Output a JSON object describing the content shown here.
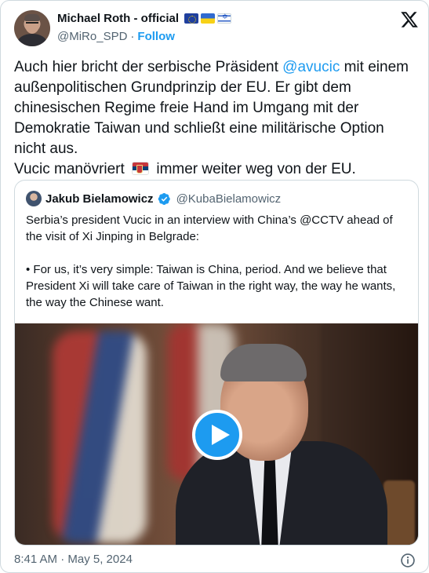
{
  "author": {
    "name": "Michael Roth - official",
    "flags": [
      "eu-flag-icon",
      "ukraine-flag-icon",
      "israel-flag-icon"
    ],
    "handle": "@MiRo_SPD",
    "separator": "·",
    "follow_label": "Follow"
  },
  "logo_icon": "x-logo-icon",
  "tweet": {
    "line1_pre": "Auch hier bricht der serbische Präsident ",
    "mention": "@avucic",
    "line1_post": " mit einem außenpolitischen Grundprinzip der EU. Er gibt dem chinesischen Regime freie Hand im Umgang mit der Demokratie Taiwan und schließt eine militärische Option nicht aus.",
    "line2_pre": "Vucic manövriert ",
    "line2_flag": "serbia-flag-icon",
    "line2_post": " immer weiter weg von der EU."
  },
  "quoted": {
    "name": "Jakub Bielamowicz",
    "verified": true,
    "handle": "@KubaBielamowicz",
    "text": "Serbia’s president Vucic in an interview with China’s @CCTV ahead of the visit of Xi Jinping in Belgrade:\n\n• For us, it’s very simple: Taiwan is China, period. And we believe that President Xi will take care of Taiwan in the right way, the way he wants, the way the Chinese want.",
    "media": "video",
    "play_icon": "play-icon"
  },
  "timestamp": "8:41 AM · May 5, 2024",
  "info_icon": "info-icon",
  "colors": {
    "accent": "#1d9bf0",
    "text": "#0f1419",
    "muted": "#536471",
    "border": "#cfd9de"
  }
}
